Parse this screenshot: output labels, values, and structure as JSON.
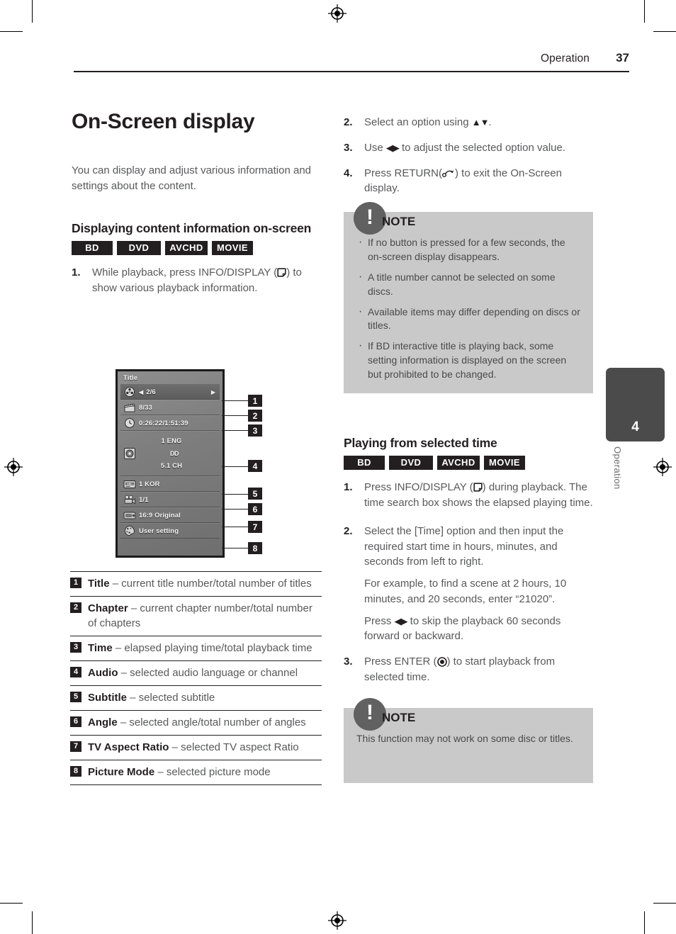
{
  "header": {
    "section": "Operation",
    "page_number": "37"
  },
  "left": {
    "title": "On-Screen display",
    "intro": "You can display and adjust various information and settings about the content.",
    "subsection_title": "Displaying content information on-screen",
    "badges": [
      "BD",
      "DVD",
      "AVCHD",
      "MOVIE"
    ],
    "step1": {
      "num": "1.",
      "text_before": "While playback, press INFO/DISPLAY (",
      "text_after": ") to show various playback information."
    }
  },
  "figure": {
    "osd_title": "Title",
    "rows": [
      {
        "icon": "film-reel-icon",
        "value": "2/6",
        "selected": true
      },
      {
        "icon": "clapperboard-icon",
        "value": "8/33",
        "selected": false
      },
      {
        "icon": "clock-icon",
        "value": "0:26:22/1:51:39",
        "selected": false
      },
      {
        "icon": "audio-disc-icon",
        "value_lines": [
          "1 ENG",
          "DD",
          "5.1 CH"
        ],
        "selected": false
      },
      {
        "icon": "subtitle-abc-icon",
        "value": "1 KOR",
        "selected": false
      },
      {
        "icon": "camera-angle-icon",
        "value": "1/1",
        "selected": false
      },
      {
        "icon": "tv-aspect-icon",
        "value": "16:9 Original",
        "selected": false
      },
      {
        "icon": "palette-icon",
        "value": "User setting",
        "selected": false
      }
    ],
    "callouts": [
      "1",
      "2",
      "3",
      "4",
      "5",
      "6",
      "7",
      "8"
    ]
  },
  "legend": [
    {
      "num": "1",
      "term": "Title",
      "desc": " – current title number/total number of titles"
    },
    {
      "num": "2",
      "term": "Chapter",
      "desc": " – current chapter number/total number of chapters"
    },
    {
      "num": "3",
      "term": "Time",
      "desc": " – elapsed playing time/total playback time"
    },
    {
      "num": "4",
      "term": "Audio",
      "desc": " – selected audio language or channel"
    },
    {
      "num": "5",
      "term": "Subtitle",
      "desc": " – selected subtitle"
    },
    {
      "num": "6",
      "term": "Angle",
      "desc": " – selected angle/total number of angles"
    },
    {
      "num": "7",
      "term": "TV Aspect Ratio",
      "desc": " – selected TV aspect Ratio"
    },
    {
      "num": "8",
      "term": "Picture Mode",
      "desc": " – selected picture mode"
    }
  ],
  "right": {
    "step2": {
      "num": "2.",
      "text_before": "Select an option using ",
      "arrows": "▲▼",
      "text_after": "."
    },
    "step3": {
      "num": "3.",
      "text_before": "Use ",
      "arrows": "◀▶",
      "text_after": " to adjust the selected option value."
    },
    "step4": {
      "num": "4.",
      "text_before": "Press RETURN(",
      "text_after": ") to exit the On-Screen display."
    },
    "note1": {
      "label": "NOTE",
      "bullets": [
        "If no button is pressed for a few seconds, the on-screen display disappears.",
        "A title number cannot be selected on some discs.",
        "Available items may differ depending on discs or titles.",
        "If BD interactive title is playing back, some setting information is displayed on the screen but prohibited to be changed."
      ]
    },
    "section2_title": "Playing from selected time",
    "badges2": [
      "BD",
      "DVD",
      "AVCHD",
      "MOVIE"
    ],
    "p_step1": {
      "num": "1.",
      "text_before": "Press INFO/DISPLAY (",
      "text_after": ") during playback. The time search box shows the elapsed playing time."
    },
    "p_step2": {
      "num": "2.",
      "para1": " Select the [Time] option and then input the required start time in hours, minutes, and seconds from left to right.",
      "para2": "For example, to find a scene at 2 hours, 10 minutes, and 20 seconds, enter “21020”.",
      "para3_before": "Press ",
      "para3_arrows": "◀▶",
      "para3_after": " to skip the playback 60 seconds forward or backward."
    },
    "p_step3": {
      "num": "3.",
      "text_before": "Press ENTER (",
      "text_after": ") to start playback from selected time."
    },
    "note2": {
      "label": "NOTE",
      "text": "This function may not work on some disc or titles."
    }
  },
  "side_tab": {
    "number": "4",
    "label": "Operation"
  }
}
